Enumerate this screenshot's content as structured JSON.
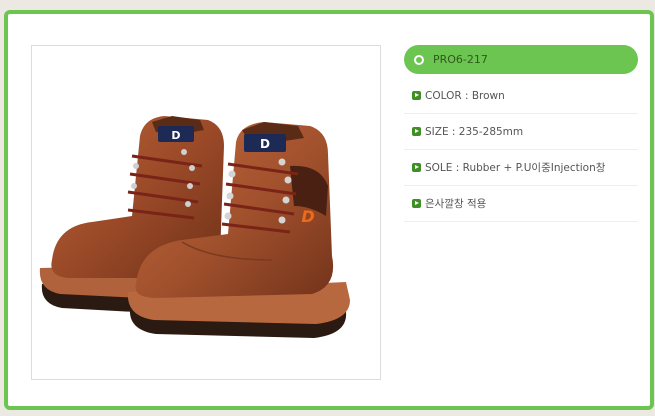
{
  "product": {
    "code": "PRO6-217",
    "specs": [
      {
        "text": "COLOR : Brown"
      },
      {
        "text": "SIZE : 235-285mm"
      },
      {
        "text": "SOLE : Rubber + P.U이중Injection창"
      },
      {
        "text": "은사깔창 적용"
      }
    ],
    "image": {
      "icon": "safety-boots-image",
      "logo_letter": "D"
    }
  },
  "colors": {
    "frame_green": "#6cc550",
    "bullet_green": "#3f8f24",
    "leather": "#9b4a28",
    "sole": "#b0623d"
  }
}
